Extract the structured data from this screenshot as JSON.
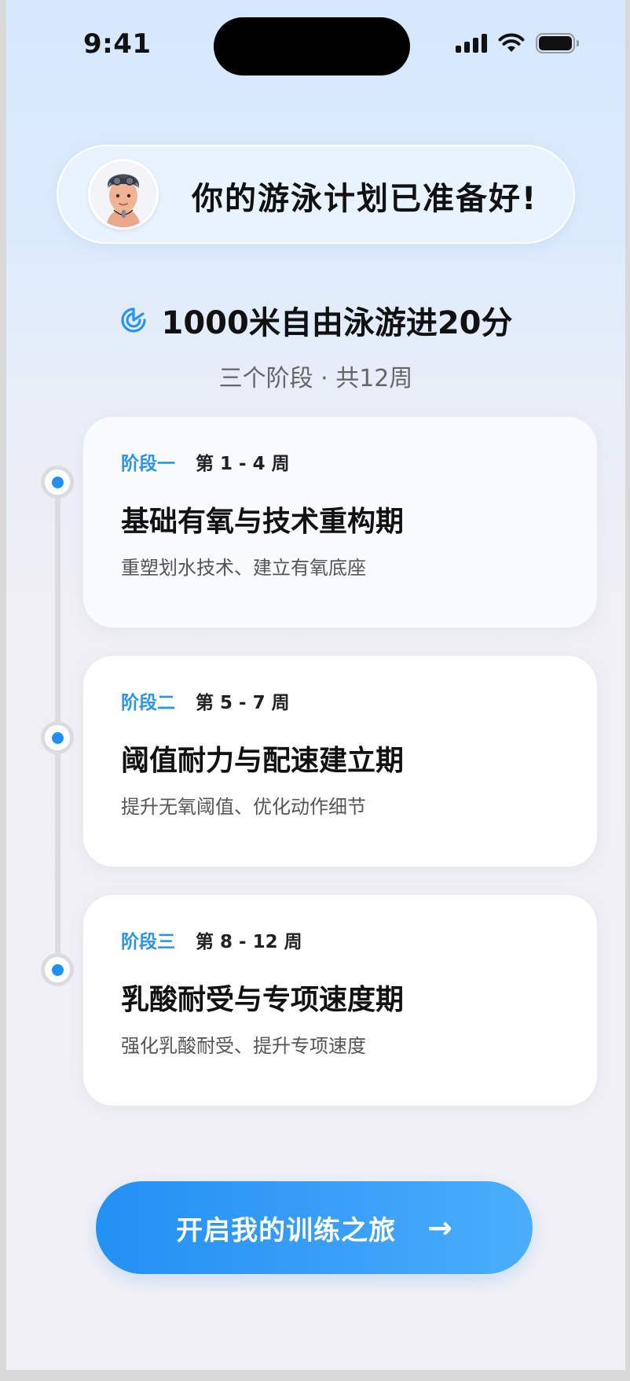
{
  "status_bar": {
    "time": "9:41"
  },
  "header": {
    "title": "你的游泳计划已准备好!"
  },
  "goal": {
    "title": "1000米自由泳游进20分",
    "subtitle": "三个阶段 · 共12周"
  },
  "stages": [
    {
      "label": "阶段一",
      "weeks": "第 1 - 4 周",
      "title": "基础有氧与技术重构期",
      "desc": "重塑划水技术、建立有氧底座"
    },
    {
      "label": "阶段二",
      "weeks": "第 5 - 7 周",
      "title": "阈值耐力与配速建立期",
      "desc": "提升无氧阈值、优化动作细节"
    },
    {
      "label": "阶段三",
      "weeks": "第 8 - 12 周",
      "title": "乳酸耐受与专项速度期",
      "desc": "强化乳酸耐受、提升专项速度"
    }
  ],
  "cta": {
    "label": "开启我的训练之旅",
    "arrow": "→"
  },
  "colors": {
    "accent": "#1e8ff7",
    "stage_label": "#2a93ec"
  },
  "icons": {
    "goal": "target-timer-icon",
    "avatar": "swimmer-avatar",
    "cta": "arrow-right-icon"
  }
}
